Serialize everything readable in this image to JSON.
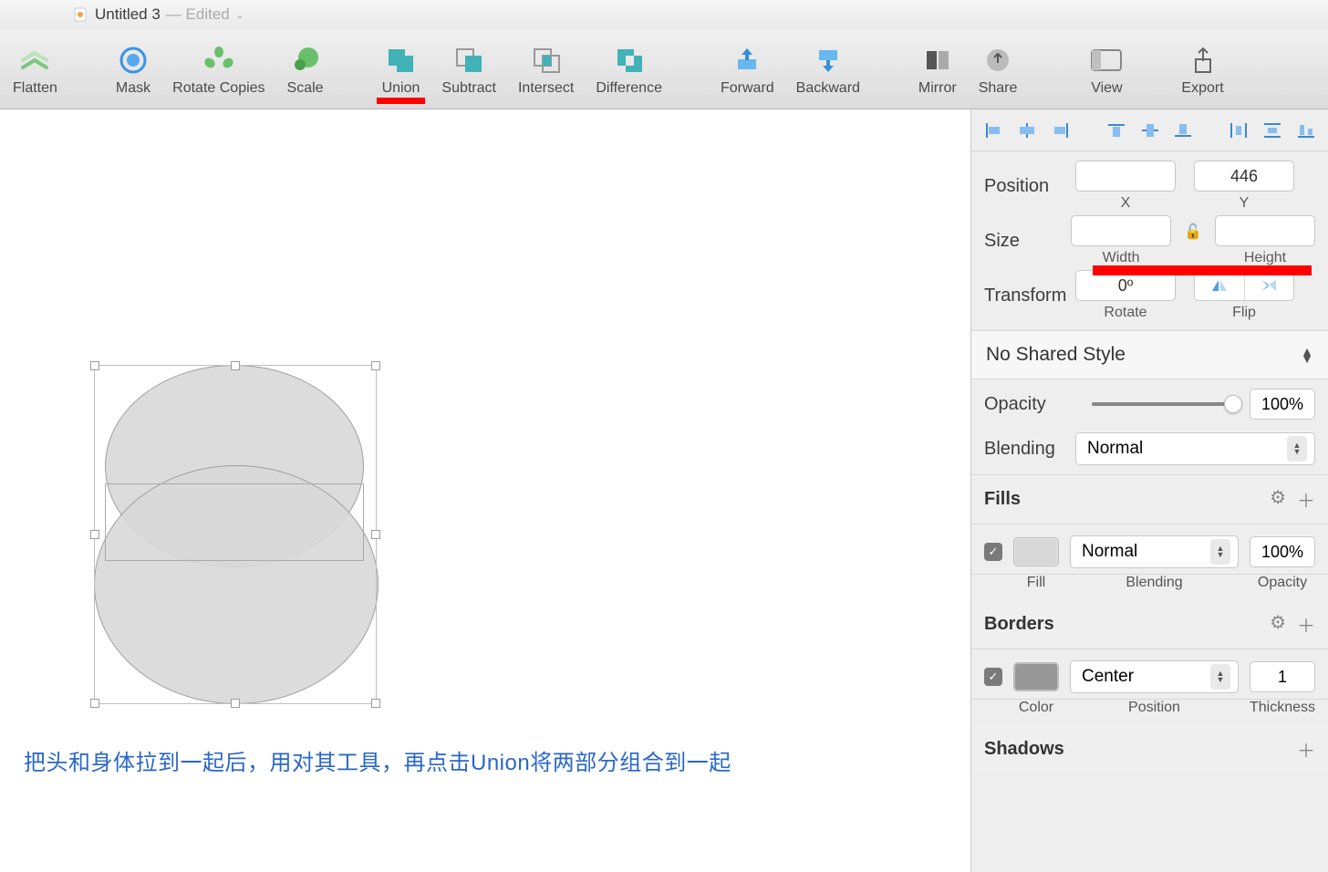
{
  "title": {
    "filename": "Untitled 3",
    "status": "— Edited"
  },
  "toolbar": {
    "flatten": "Flatten",
    "mask": "Mask",
    "rotate_copies": "Rotate Copies",
    "scale": "Scale",
    "union": "Union",
    "subtract": "Subtract",
    "intersect": "Intersect",
    "difference": "Difference",
    "forward": "Forward",
    "backward": "Backward",
    "mirror": "Mirror",
    "share": "Share",
    "view": "View",
    "export": "Export"
  },
  "caption": "把头和身体拉到一起后，用对其工具，再点击Union将两部分组合到一起",
  "inspector": {
    "position": {
      "label": "Position",
      "x_value": "",
      "y_value": "446",
      "x_label": "X",
      "y_label": "Y"
    },
    "size": {
      "label": "Size",
      "w_value": "",
      "h_value": "",
      "w_label": "Width",
      "h_label": "Height"
    },
    "transform": {
      "label": "Transform",
      "rotate_value": "0º",
      "rotate_label": "Rotate",
      "flip_label": "Flip"
    },
    "shared_style": "No Shared Style",
    "opacity": {
      "label": "Opacity",
      "value": "100%"
    },
    "blending": {
      "label": "Blending",
      "value": "Normal"
    },
    "fills": {
      "title": "Fills",
      "blending": "Normal",
      "opacity": "100%",
      "fill_label": "Fill",
      "blending_label": "Blending",
      "opacity_label": "Opacity",
      "swatch_color": "#d8d8d8"
    },
    "borders": {
      "title": "Borders",
      "position": "Center",
      "thickness": "1",
      "color_label": "Color",
      "position_label": "Position",
      "thickness_label": "Thickness",
      "swatch_color": "#979797"
    },
    "shadows": {
      "title": "Shadows"
    }
  }
}
